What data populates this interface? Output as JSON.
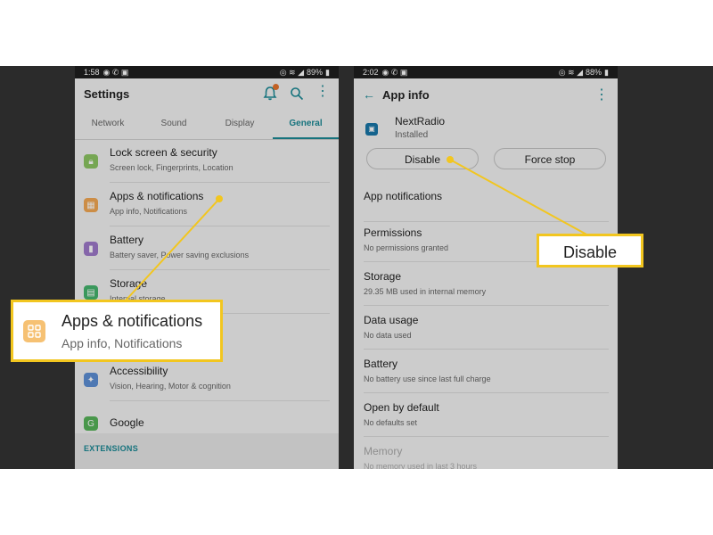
{
  "left_phone": {
    "status_bar": {
      "time": "1:58",
      "icons": "◉ ✆ ▣",
      "right_icons": "◎ ≋ ◢",
      "battery": "89%",
      "battery_icon": "▮"
    },
    "title": "Settings",
    "tabs": [
      "Network",
      "Sound",
      "Display",
      "General"
    ],
    "active_tab": "General",
    "items": [
      {
        "title": "Lock screen & security",
        "subtitle": "Screen lock, Fingerprints, Location",
        "icon": "lock-icon",
        "color": "#8dc663"
      },
      {
        "title": "Apps & notifications",
        "subtitle": "App info, Notifications",
        "icon": "apps-icon",
        "color": "#f3a854"
      },
      {
        "title": "Battery",
        "subtitle": "Battery saver, Power saving exclusions",
        "icon": "battery-icon",
        "color": "#9f7acb"
      },
      {
        "title": "Storage",
        "subtitle": "Internal storage",
        "icon": "storage-icon",
        "color": "#46b56e"
      },
      {
        "title": "",
        "subtitle": "",
        "icon": "",
        "color": "#f4f4f4"
      },
      {
        "title": "Accessibility",
        "subtitle": "Vision, Hearing, Motor & cognition",
        "icon": "accessibility-icon",
        "color": "#5d8fd6"
      },
      {
        "title": "Google",
        "subtitle": "",
        "icon": "google-icon",
        "color": "#58b45a"
      }
    ],
    "extensions_label": "EXTENSIONS"
  },
  "right_phone": {
    "status_bar": {
      "time": "2:02",
      "icons": "◉ ✆ ▣",
      "right_icons": "◎ ≋ ◢",
      "battery": "88%",
      "battery_icon": "▮"
    },
    "title": "App info",
    "app_name": "NextRadio",
    "app_status": "Installed",
    "disable_label": "Disable",
    "force_stop_label": "Force stop",
    "rows": [
      {
        "title": "App notifications",
        "subtitle": ""
      },
      {
        "title": "Permissions",
        "subtitle": "No permissions granted"
      },
      {
        "title": "Storage",
        "subtitle": "29.35 MB used in internal memory"
      },
      {
        "title": "Data usage",
        "subtitle": "No data used"
      },
      {
        "title": "Battery",
        "subtitle": "No battery use since last full charge"
      },
      {
        "title": "Open by default",
        "subtitle": "No defaults set"
      },
      {
        "title": "Memory",
        "subtitle": "No memory used in last 3 hours"
      }
    ]
  },
  "callouts": {
    "left": {
      "title": "Apps & notifications",
      "subtitle": "App info, Notifications"
    },
    "right": {
      "label": "Disable"
    }
  },
  "colors": {
    "accent": "#1b8a96",
    "highlight": "#f2c61f"
  }
}
